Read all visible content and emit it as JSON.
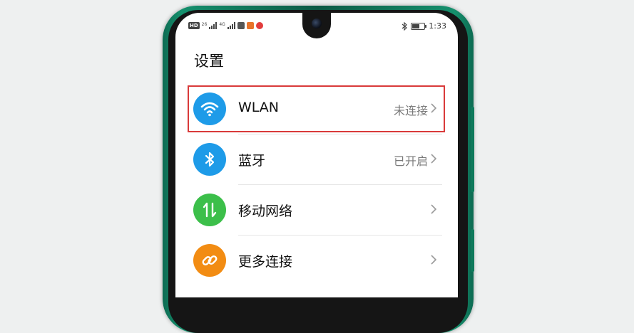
{
  "status_bar": {
    "hd_tag": "HD",
    "net_1": "26",
    "net_2": "4G",
    "time": "1:33"
  },
  "page": {
    "title": "设置"
  },
  "settings_items": [
    {
      "label": "WLAN",
      "status": "未连接",
      "icon": "wifi-icon",
      "color": "#1e9be8"
    },
    {
      "label": "蓝牙",
      "status": "已开启",
      "icon": "bluetooth-icon",
      "color": "#1e9be8"
    },
    {
      "label": "移动网络",
      "status": "",
      "icon": "mobile-data-icon",
      "color": "#3cbf4a"
    },
    {
      "label": "更多连接",
      "status": "",
      "icon": "link-icon",
      "color": "#f28c13"
    }
  ],
  "colors": {
    "phone_frame": "#15906d",
    "highlight": "#d93a3a",
    "status_text": "#7a7a7a"
  }
}
